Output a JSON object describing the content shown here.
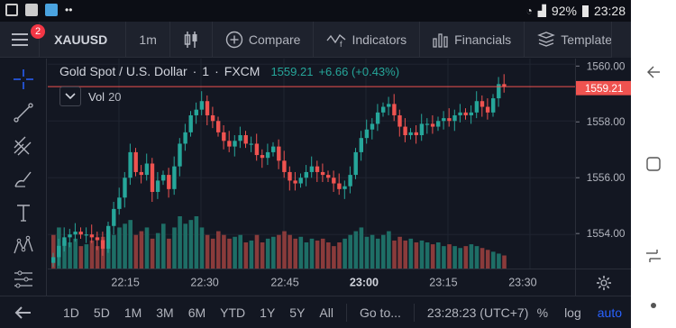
{
  "status": {
    "battery": "92%",
    "time": "23:28"
  },
  "toolbar": {
    "notifications": "2",
    "symbol": "XAUUSD",
    "interval": "1m",
    "compare": "Compare",
    "indicators": "Indicators",
    "financials": "Financials",
    "templates": "Templates"
  },
  "legend": {
    "title": "Gold Spot / U.S. Dollar",
    "sep1": "·",
    "interval": "1",
    "sep2": "·",
    "exchange": "FXCM",
    "last": "1559.21",
    "change": "+6.66 (+0.43%)",
    "vol_label": "Vol",
    "vol_length": "20"
  },
  "price_axis": {
    "ticks": [
      "1560.00",
      "1558.00",
      "1556.00",
      "1554.00"
    ],
    "last_label": "1559.21"
  },
  "time_axis": {
    "ticks": [
      "22:15",
      "22:30",
      "22:45",
      "23:00",
      "23:15",
      "23:30"
    ]
  },
  "bottom": {
    "ranges": [
      "1D",
      "5D",
      "1M",
      "3M",
      "6M",
      "YTD",
      "1Y",
      "5Y",
      "All"
    ],
    "goto": "Go to...",
    "clock": "23:28:23 (UTC+7)",
    "percent": "%",
    "log": "log",
    "auto": "auto"
  },
  "colors": {
    "up": "#26a69a",
    "down": "#ef5350",
    "accent": "#2962ff",
    "background": "#131722"
  },
  "chart_data": {
    "type": "candlestick",
    "title": "Gold Spot / U.S. Dollar · 1 · FXCM",
    "ylim": [
      1552.8,
      1560.2
    ],
    "y_ticks": [
      1554.0,
      1556.0,
      1558.0,
      1560.0
    ],
    "x_ticks": [
      "22:15",
      "22:30",
      "22:45",
      "23:00",
      "23:15",
      "23:30"
    ],
    "last_price": 1559.21,
    "candles_close": [
      1553.2,
      1553.6,
      1553.9,
      1554.0,
      1554.1,
      1554.0,
      1554.0,
      1553.9,
      1553.8,
      1553.5,
      1554.3,
      1554.9,
      1555.3,
      1556.0,
      1556.9,
      1556.2,
      1556.1,
      1556.5,
      1555.5,
      1555.9,
      1556.1,
      1555.6,
      1556.4,
      1557.2,
      1557.6,
      1558.2,
      1558.4,
      1558.7,
      1558.2,
      1558.0,
      1557.6,
      1557.3,
      1557.1,
      1557.3,
      1557.5,
      1557.2,
      1557.2,
      1556.8,
      1556.7,
      1556.9,
      1557.1,
      1556.6,
      1556.2,
      1555.9,
      1555.8,
      1556.0,
      1556.2,
      1556.4,
      1556.2,
      1556.1,
      1556.0,
      1555.8,
      1555.6,
      1555.7,
      1556.1,
      1556.9,
      1557.4,
      1557.7,
      1557.9,
      1558.3,
      1558.5,
      1558.6,
      1558.2,
      1557.8,
      1557.5,
      1557.6,
      1557.5,
      1557.9,
      1557.9,
      1557.8,
      1558.0,
      1558.1,
      1558.0,
      1558.2,
      1558.3,
      1558.2,
      1558.3,
      1558.7,
      1558.5,
      1558.3,
      1558.8,
      1559.3,
      1559.2
    ],
    "volumes": [
      18,
      22,
      15,
      14,
      16,
      12,
      13,
      15,
      12,
      17,
      20,
      18,
      22,
      24,
      26,
      18,
      20,
      22,
      16,
      19,
      24,
      16,
      22,
      28,
      24,
      26,
      28,
      22,
      18,
      16,
      20,
      18,
      16,
      17,
      18,
      14,
      15,
      18,
      14,
      16,
      17,
      18,
      20,
      18,
      16,
      17,
      14,
      16,
      15,
      16,
      14,
      12,
      14,
      16,
      18,
      20,
      22,
      17,
      18,
      16,
      18,
      20,
      15,
      17,
      15,
      16,
      14,
      15,
      14,
      13,
      14,
      12,
      13,
      12,
      11,
      12,
      13,
      12,
      11,
      10,
      9,
      8,
      7
    ],
    "volume_colors": [
      "down",
      "up",
      "up",
      "up",
      "up",
      "down",
      "up",
      "down",
      "down",
      "down",
      "up",
      "up",
      "up",
      "up",
      "up",
      "down",
      "down",
      "up",
      "down",
      "up",
      "up",
      "down",
      "up",
      "up",
      "up",
      "up",
      "up",
      "up",
      "down",
      "down",
      "down",
      "down",
      "down",
      "up",
      "up",
      "down",
      "up",
      "down",
      "down",
      "up",
      "up",
      "down",
      "down",
      "down",
      "down",
      "up",
      "up",
      "up",
      "down",
      "down",
      "down",
      "down",
      "down",
      "up",
      "up",
      "up",
      "up",
      "up",
      "up",
      "up",
      "up",
      "up",
      "down",
      "down",
      "down",
      "up",
      "down",
      "up",
      "up",
      "down",
      "up",
      "up",
      "down",
      "up",
      "up",
      "down",
      "up",
      "up",
      "down",
      "down",
      "up",
      "up",
      "down"
    ]
  }
}
